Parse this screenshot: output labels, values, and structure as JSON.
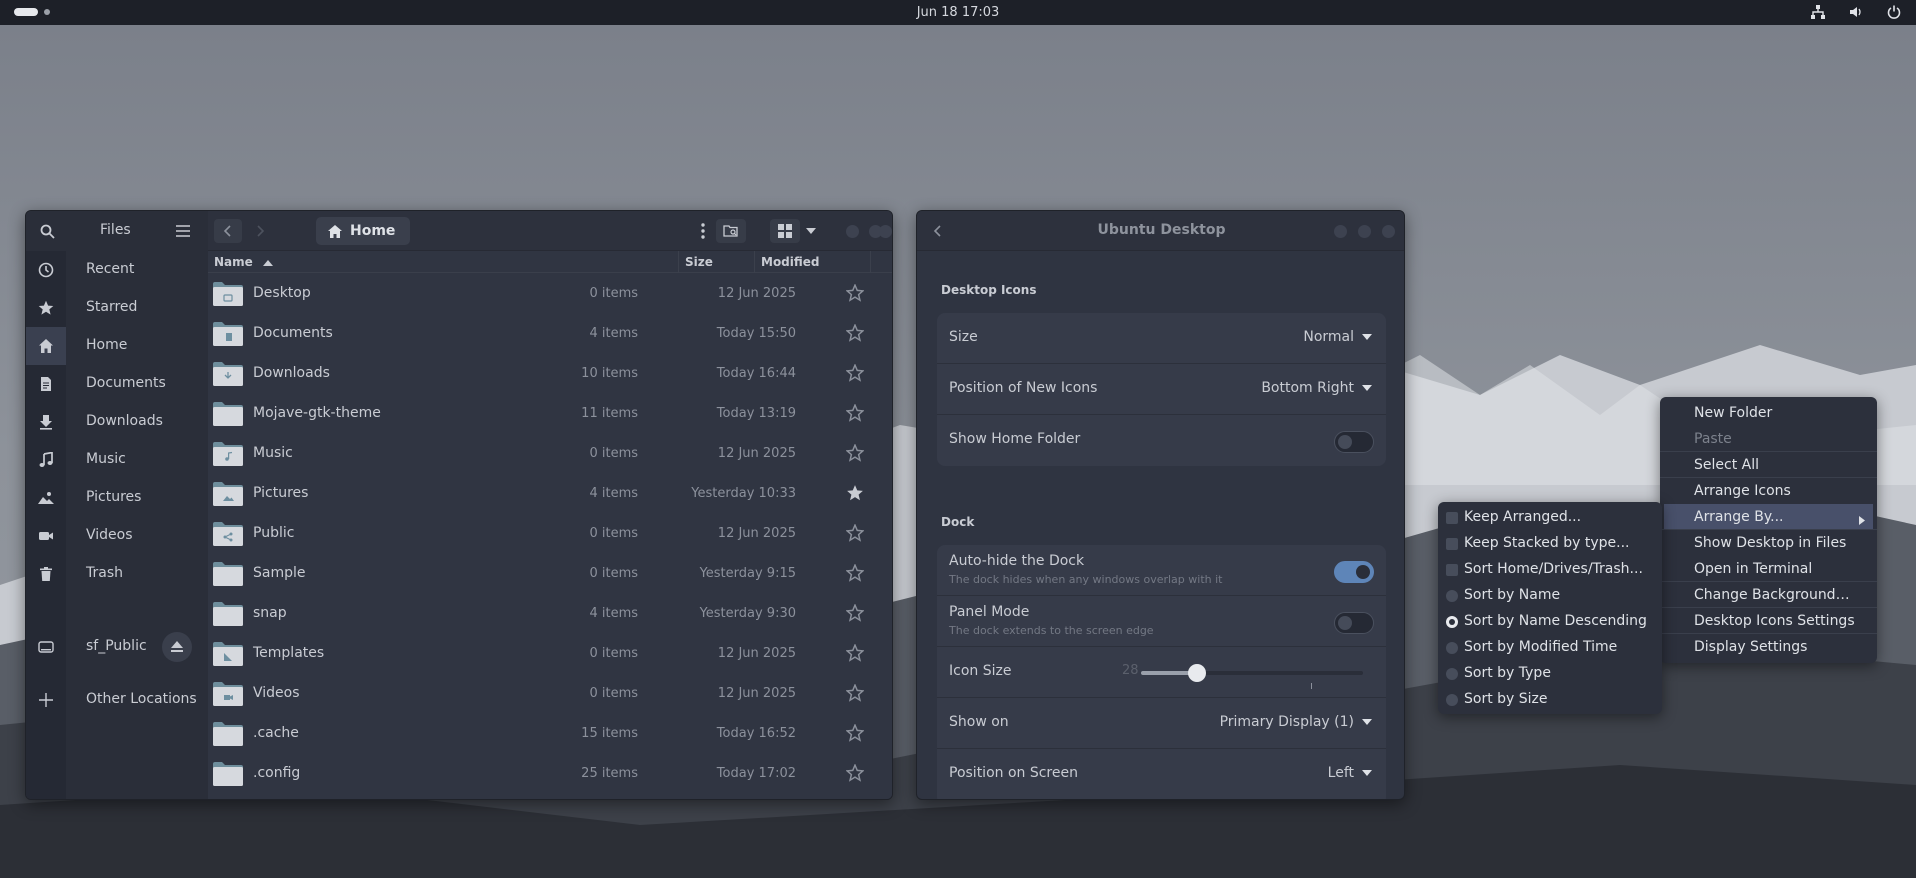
{
  "topbar": {
    "clock": "Jun 18  17:03"
  },
  "files": {
    "sidebar_title": "Files",
    "location": "Home",
    "places": [
      {
        "label": "Recent",
        "icon": "clock-icon"
      },
      {
        "label": "Starred",
        "icon": "star-icon"
      },
      {
        "label": "Home",
        "icon": "home-icon"
      },
      {
        "label": "Documents",
        "icon": "document-icon"
      },
      {
        "label": "Downloads",
        "icon": "download-icon"
      },
      {
        "label": "Music",
        "icon": "music-icon"
      },
      {
        "label": "Pictures",
        "icon": "pictures-icon"
      },
      {
        "label": "Videos",
        "icon": "video-icon"
      },
      {
        "label": "Trash",
        "icon": "trash-icon"
      }
    ],
    "device": {
      "label": "sf_Public"
    },
    "other_locations": "Other Locations",
    "columns": {
      "name": "Name",
      "size": "Size",
      "modified": "Modified"
    },
    "rows": [
      {
        "name": "Desktop",
        "size": "0 items",
        "modified": "12 Jun 2025",
        "starred": false
      },
      {
        "name": "Documents",
        "size": "4 items",
        "modified": "Today 15:50",
        "starred": false
      },
      {
        "name": "Downloads",
        "size": "10 items",
        "modified": "Today 16:44",
        "starred": false
      },
      {
        "name": "Mojave-gtk-theme",
        "size": "11 items",
        "modified": "Today 13:19",
        "starred": false
      },
      {
        "name": "Music",
        "size": "0 items",
        "modified": "12 Jun 2025",
        "starred": false
      },
      {
        "name": "Pictures",
        "size": "4 items",
        "modified": "Yesterday 10:33",
        "starred": true
      },
      {
        "name": "Public",
        "size": "0 items",
        "modified": "12 Jun 2025",
        "starred": false
      },
      {
        "name": "Sample",
        "size": "0 items",
        "modified": "Yesterday 9:15",
        "starred": false
      },
      {
        "name": "snap",
        "size": "4 items",
        "modified": "Yesterday 9:30",
        "starred": false
      },
      {
        "name": "Templates",
        "size": "0 items",
        "modified": "12 Jun 2025",
        "starred": false
      },
      {
        "name": "Videos",
        "size": "0 items",
        "modified": "12 Jun 2025",
        "starred": false
      },
      {
        "name": ".cache",
        "size": "15 items",
        "modified": "Today 16:52",
        "starred": false
      },
      {
        "name": ".config",
        "size": "25 items",
        "modified": "Today 17:02",
        "starred": false
      }
    ]
  },
  "settings": {
    "title": "Ubuntu Desktop",
    "desktop_icons": {
      "section": "Desktop Icons",
      "size_label": "Size",
      "size_value": "Normal",
      "position_label": "Position of New Icons",
      "position_value": "Bottom Right",
      "home_label": "Show Home Folder",
      "home_on": false
    },
    "dock": {
      "section": "Dock",
      "autohide_label": "Auto-hide the Dock",
      "autohide_sub": "The dock hides when any windows overlap with it",
      "autohide_on": true,
      "panel_label": "Panel Mode",
      "panel_sub": "The dock extends to the screen edge",
      "panel_on": false,
      "iconsize_label": "Icon Size",
      "iconsize_value": "28",
      "showon_label": "Show on",
      "showon_value": "Primary Display (1)",
      "position_label": "Position on Screen",
      "position_value": "Left"
    }
  },
  "context_menu": {
    "items": [
      {
        "label": "New Folder",
        "disabled": false
      },
      {
        "label": "Paste",
        "disabled": true
      },
      {
        "label": "Select All",
        "disabled": false
      },
      {
        "label": "Arrange Icons",
        "disabled": false
      },
      {
        "label": "Arrange By...",
        "disabled": false,
        "highlighted": true,
        "submenu": true
      },
      {
        "label": "Show Desktop in Files",
        "disabled": false
      },
      {
        "label": "Open in Terminal",
        "disabled": false
      },
      {
        "label": "Change Background…",
        "disabled": false
      },
      {
        "label": "Desktop Icons Settings",
        "disabled": false
      },
      {
        "label": "Display Settings",
        "disabled": false
      }
    ]
  },
  "arrange_submenu": {
    "checks": [
      {
        "label": "Keep Arranged...",
        "checked": false
      },
      {
        "label": "Keep Stacked by type...",
        "checked": false
      },
      {
        "label": "Sort Home/Drives/Trash...",
        "checked": false
      }
    ],
    "radios": [
      {
        "label": "Sort by Name",
        "selected": false
      },
      {
        "label": "Sort by Name Descending",
        "selected": true
      },
      {
        "label": "Sort by Modified Time",
        "selected": false
      },
      {
        "label": "Sort by Type",
        "selected": false
      },
      {
        "label": "Sort by Size",
        "selected": false
      }
    ]
  }
}
